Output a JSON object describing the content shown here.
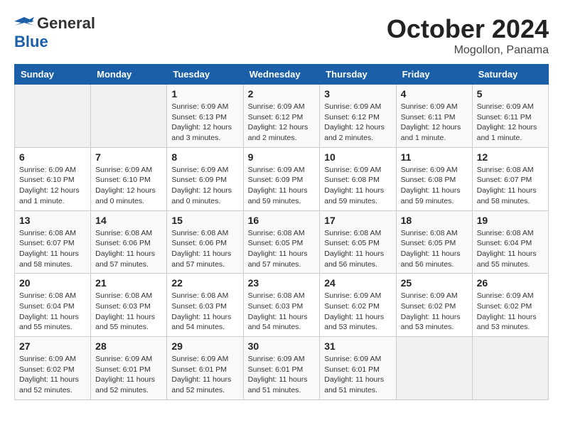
{
  "header": {
    "logo_line1": "General",
    "logo_line2": "Blue",
    "month": "October 2024",
    "location": "Mogollon, Panama"
  },
  "weekdays": [
    "Sunday",
    "Monday",
    "Tuesday",
    "Wednesday",
    "Thursday",
    "Friday",
    "Saturday"
  ],
  "weeks": [
    [
      {
        "day": "",
        "info": ""
      },
      {
        "day": "",
        "info": ""
      },
      {
        "day": "1",
        "info": "Sunrise: 6:09 AM\nSunset: 6:13 PM\nDaylight: 12 hours\nand 3 minutes."
      },
      {
        "day": "2",
        "info": "Sunrise: 6:09 AM\nSunset: 6:12 PM\nDaylight: 12 hours\nand 2 minutes."
      },
      {
        "day": "3",
        "info": "Sunrise: 6:09 AM\nSunset: 6:12 PM\nDaylight: 12 hours\nand 2 minutes."
      },
      {
        "day": "4",
        "info": "Sunrise: 6:09 AM\nSunset: 6:11 PM\nDaylight: 12 hours\nand 1 minute."
      },
      {
        "day": "5",
        "info": "Sunrise: 6:09 AM\nSunset: 6:11 PM\nDaylight: 12 hours\nand 1 minute."
      }
    ],
    [
      {
        "day": "6",
        "info": "Sunrise: 6:09 AM\nSunset: 6:10 PM\nDaylight: 12 hours\nand 1 minute."
      },
      {
        "day": "7",
        "info": "Sunrise: 6:09 AM\nSunset: 6:10 PM\nDaylight: 12 hours\nand 0 minutes."
      },
      {
        "day": "8",
        "info": "Sunrise: 6:09 AM\nSunset: 6:09 PM\nDaylight: 12 hours\nand 0 minutes."
      },
      {
        "day": "9",
        "info": "Sunrise: 6:09 AM\nSunset: 6:09 PM\nDaylight: 11 hours\nand 59 minutes."
      },
      {
        "day": "10",
        "info": "Sunrise: 6:09 AM\nSunset: 6:08 PM\nDaylight: 11 hours\nand 59 minutes."
      },
      {
        "day": "11",
        "info": "Sunrise: 6:09 AM\nSunset: 6:08 PM\nDaylight: 11 hours\nand 59 minutes."
      },
      {
        "day": "12",
        "info": "Sunrise: 6:08 AM\nSunset: 6:07 PM\nDaylight: 11 hours\nand 58 minutes."
      }
    ],
    [
      {
        "day": "13",
        "info": "Sunrise: 6:08 AM\nSunset: 6:07 PM\nDaylight: 11 hours\nand 58 minutes."
      },
      {
        "day": "14",
        "info": "Sunrise: 6:08 AM\nSunset: 6:06 PM\nDaylight: 11 hours\nand 57 minutes."
      },
      {
        "day": "15",
        "info": "Sunrise: 6:08 AM\nSunset: 6:06 PM\nDaylight: 11 hours\nand 57 minutes."
      },
      {
        "day": "16",
        "info": "Sunrise: 6:08 AM\nSunset: 6:05 PM\nDaylight: 11 hours\nand 57 minutes."
      },
      {
        "day": "17",
        "info": "Sunrise: 6:08 AM\nSunset: 6:05 PM\nDaylight: 11 hours\nand 56 minutes."
      },
      {
        "day": "18",
        "info": "Sunrise: 6:08 AM\nSunset: 6:05 PM\nDaylight: 11 hours\nand 56 minutes."
      },
      {
        "day": "19",
        "info": "Sunrise: 6:08 AM\nSunset: 6:04 PM\nDaylight: 11 hours\nand 55 minutes."
      }
    ],
    [
      {
        "day": "20",
        "info": "Sunrise: 6:08 AM\nSunset: 6:04 PM\nDaylight: 11 hours\nand 55 minutes."
      },
      {
        "day": "21",
        "info": "Sunrise: 6:08 AM\nSunset: 6:03 PM\nDaylight: 11 hours\nand 55 minutes."
      },
      {
        "day": "22",
        "info": "Sunrise: 6:08 AM\nSunset: 6:03 PM\nDaylight: 11 hours\nand 54 minutes."
      },
      {
        "day": "23",
        "info": "Sunrise: 6:08 AM\nSunset: 6:03 PM\nDaylight: 11 hours\nand 54 minutes."
      },
      {
        "day": "24",
        "info": "Sunrise: 6:09 AM\nSunset: 6:02 PM\nDaylight: 11 hours\nand 53 minutes."
      },
      {
        "day": "25",
        "info": "Sunrise: 6:09 AM\nSunset: 6:02 PM\nDaylight: 11 hours\nand 53 minutes."
      },
      {
        "day": "26",
        "info": "Sunrise: 6:09 AM\nSunset: 6:02 PM\nDaylight: 11 hours\nand 53 minutes."
      }
    ],
    [
      {
        "day": "27",
        "info": "Sunrise: 6:09 AM\nSunset: 6:02 PM\nDaylight: 11 hours\nand 52 minutes."
      },
      {
        "day": "28",
        "info": "Sunrise: 6:09 AM\nSunset: 6:01 PM\nDaylight: 11 hours\nand 52 minutes."
      },
      {
        "day": "29",
        "info": "Sunrise: 6:09 AM\nSunset: 6:01 PM\nDaylight: 11 hours\nand 52 minutes."
      },
      {
        "day": "30",
        "info": "Sunrise: 6:09 AM\nSunset: 6:01 PM\nDaylight: 11 hours\nand 51 minutes."
      },
      {
        "day": "31",
        "info": "Sunrise: 6:09 AM\nSunset: 6:01 PM\nDaylight: 11 hours\nand 51 minutes."
      },
      {
        "day": "",
        "info": ""
      },
      {
        "day": "",
        "info": ""
      }
    ]
  ]
}
